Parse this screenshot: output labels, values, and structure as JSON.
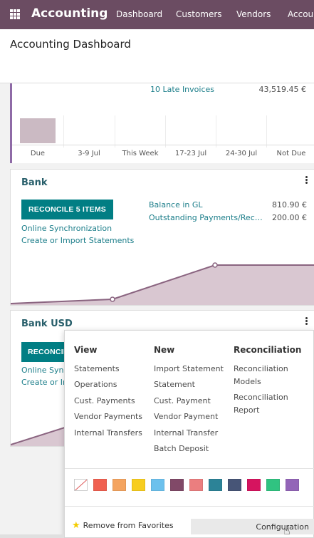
{
  "navbar": {
    "app_name": "Accounting",
    "menu": [
      "Dashboard",
      "Customers",
      "Vendors",
      "Accounting"
    ],
    "color": "#6b4c62"
  },
  "page": {
    "title": "Accounting Dashboard"
  },
  "card_invoices": {
    "late_label": "10 Late Invoices",
    "late_value": "43,519.45 €",
    "chart_data": {
      "type": "bar",
      "categories": [
        "Due",
        "3-9 Jul",
        "This Week",
        "17-23 Jul",
        "24-30 Jul",
        "Not Due"
      ],
      "values": [
        1,
        0,
        0,
        0,
        0,
        0
      ]
    }
  },
  "card_bank": {
    "title": "Bank",
    "reconcile_label": "RECONCILE 5 ITEMS",
    "links": [
      "Online Synchronization",
      "Create or Import Statements"
    ],
    "balance_label": "Balance in GL",
    "balance_value": "810.90 €",
    "outstanding_label": "Outstanding Payments/Rec…",
    "outstanding_value": "200.00 €",
    "chart_data": {
      "type": "line",
      "values": [
        0,
        1,
        5,
        5
      ]
    }
  },
  "card_bank_usd": {
    "title": "Bank USD",
    "reconcile_label": "RECONCILE",
    "links": [
      "Online Synchronization",
      "Create or Import Statements"
    ]
  },
  "dropdown": {
    "view": {
      "heading": "View",
      "items": [
        "Statements",
        "Operations",
        "Cust. Payments",
        "Vendor Payments",
        "Internal Transfers"
      ]
    },
    "new": {
      "heading": "New",
      "items": [
        "Import Statement",
        "Statement",
        "Cust. Payment",
        "Vendor Payment",
        "Internal Transfer",
        "Batch Deposit"
      ]
    },
    "reconciliation": {
      "heading": "Reconciliation",
      "items": [
        "Reconciliation Models",
        "Reconciliation Report"
      ]
    },
    "colors": [
      "none",
      "#f06050",
      "#f4a460",
      "#f7cd1f",
      "#6cc1ed",
      "#814968",
      "#eb7e7f",
      "#2c8397",
      "#475577",
      "#d6145f",
      "#30c381",
      "#9365b8"
    ],
    "favorite_label": "Remove from Favorites",
    "configuration_label": "Configuration"
  }
}
